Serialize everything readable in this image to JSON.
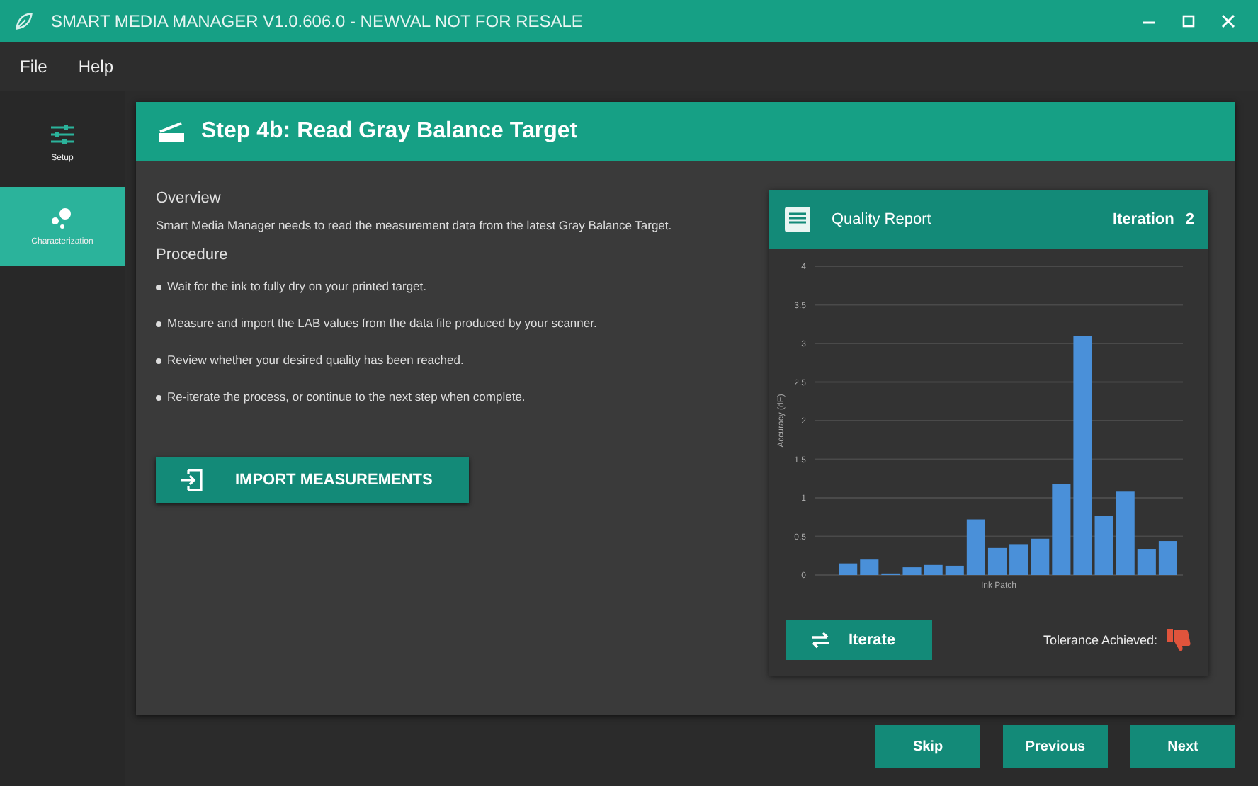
{
  "window": {
    "title": "SMART MEDIA MANAGER V1.0.606.0 - NEWVAL NOT FOR RESALE"
  },
  "menu": [
    "File",
    "Help"
  ],
  "sidebar": {
    "items": [
      {
        "label": "Setup",
        "kind": "sliders",
        "selected": false
      },
      {
        "label": "Characterization",
        "kind": "dots",
        "selected": true
      }
    ]
  },
  "step": {
    "title": "Step 4b: Read Gray Balance Target",
    "overview_heading": "Overview",
    "overview_text": "Smart Media Manager needs to read the measurement data from the latest Gray Balance Target.",
    "procedure_heading": "Procedure",
    "procedure": [
      "Wait for the ink to fully dry on your printed target.",
      "Measure and import the LAB values from the data file produced by your scanner.",
      "Review whether your desired quality has been reached.",
      "Re-iterate the process, or continue to the next step when complete."
    ],
    "import_button": "IMPORT MEASUREMENTS"
  },
  "quality_report": {
    "title": "Quality Report",
    "iteration_label": "Iteration",
    "iteration": "2",
    "chart_data": {
      "type": "bar",
      "xlabel": "Ink Patch",
      "ylabel": "Accuracy (dE)",
      "ylim": [
        0,
        4
      ],
      "yticks": [
        0,
        0.5,
        1,
        1.5,
        2,
        2.5,
        3,
        3.5,
        4
      ],
      "grid": true,
      "series": [
        {
          "color": "#4a90d9",
          "values": [
            null,
            0.15,
            0.2,
            0.02,
            0.1,
            0.13,
            0.12,
            0.72,
            0.35,
            0.4,
            0.47,
            1.18,
            3.1,
            0.77,
            1.08,
            0.33,
            0.44
          ]
        }
      ]
    },
    "iterate_button": "Iterate",
    "tolerance_label": "Tolerance Achieved:",
    "tolerance_achieved": false
  },
  "footer_buttons": [
    "Skip",
    "Previous",
    "Next"
  ]
}
